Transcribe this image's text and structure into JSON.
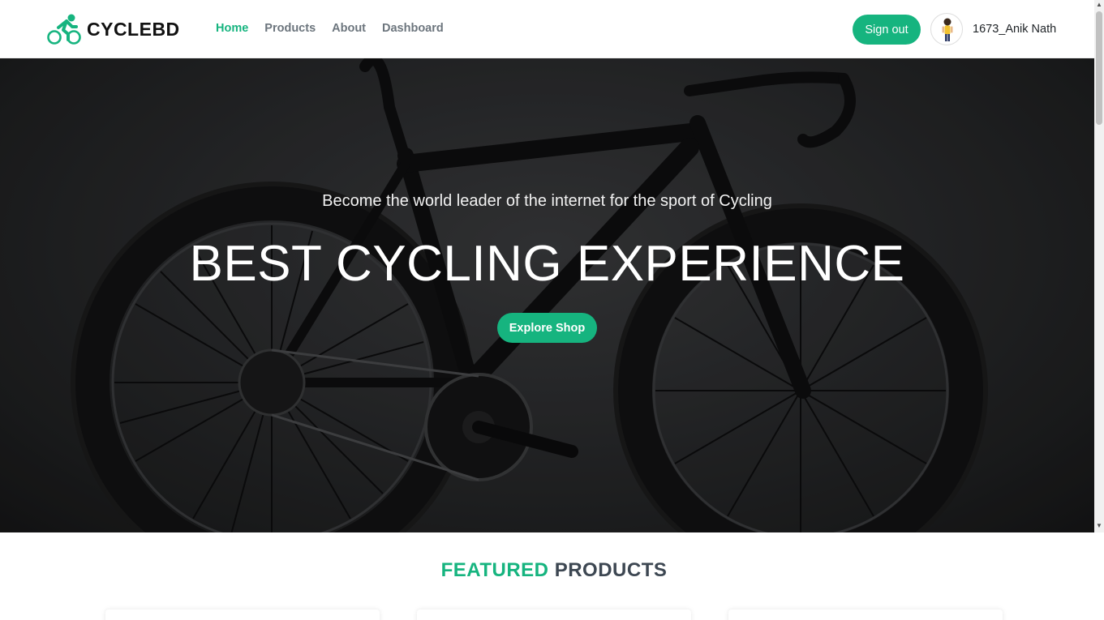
{
  "brand": {
    "name": "CYCLEBD",
    "icon": "bicycle-rider-icon",
    "accent": "#16b47f"
  },
  "nav": {
    "items": [
      {
        "label": "Home",
        "active": true
      },
      {
        "label": "Products",
        "active": false
      },
      {
        "label": "About",
        "active": false
      },
      {
        "label": "Dashboard",
        "active": false
      }
    ]
  },
  "user": {
    "signout_label": "Sign out",
    "name": "1673_Anik Nath",
    "avatar_icon": "user-avatar-icon"
  },
  "hero": {
    "subtitle": "Become the world leader of the internet for the sport of Cycling",
    "title": "BEST CYCLING EXPERIENCE",
    "cta_label": "Explore Shop",
    "background": "road-bike-photo"
  },
  "featured": {
    "heading_accent": "FEATURED",
    "heading_rest": "PRODUCTS",
    "card_count": 3
  },
  "colors": {
    "primary": "#16b47f",
    "nav_text": "#6c757d",
    "heading_dark": "#3d4752"
  }
}
